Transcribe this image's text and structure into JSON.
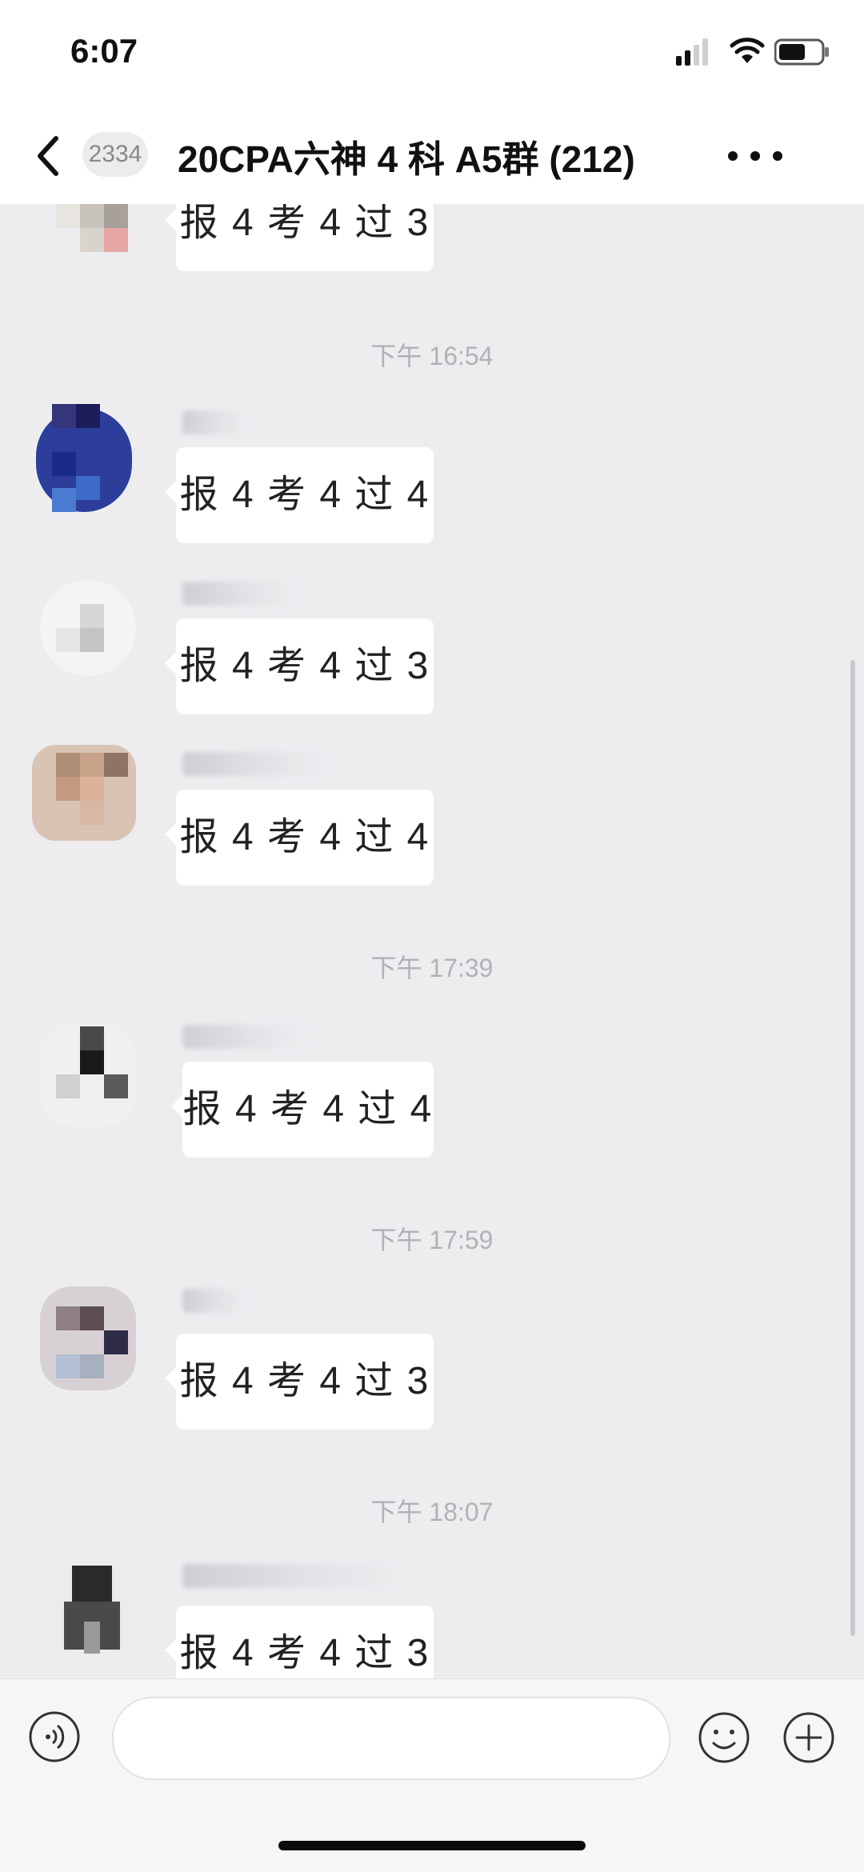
{
  "status_bar": {
    "time": "6:07"
  },
  "header": {
    "unread_count": "2334",
    "title": "20CPA六神 4 科 A5群 (212)"
  },
  "messages": [
    {
      "text": "报 4 考 4 过 3"
    },
    {
      "text": "报 4 考 4 过 4"
    },
    {
      "text": "报 4 考 4 过 3"
    },
    {
      "text": "报 4 考 4 过 4"
    },
    {
      "text": "报 4 考 4 过 4"
    },
    {
      "text": "报 4 考 4 过 3"
    },
    {
      "text": "报 4 考 4 过 3"
    }
  ],
  "timestamps": [
    "下午 16:54",
    "下午 17:39",
    "下午 17:59",
    "下午 18:07"
  ],
  "input": {
    "placeholder": ""
  },
  "icons": {
    "back": "chevron-left-icon",
    "more": "more-dots-icon",
    "voice": "voice-icon",
    "emoji": "emoji-icon",
    "plus": "plus-icon"
  }
}
